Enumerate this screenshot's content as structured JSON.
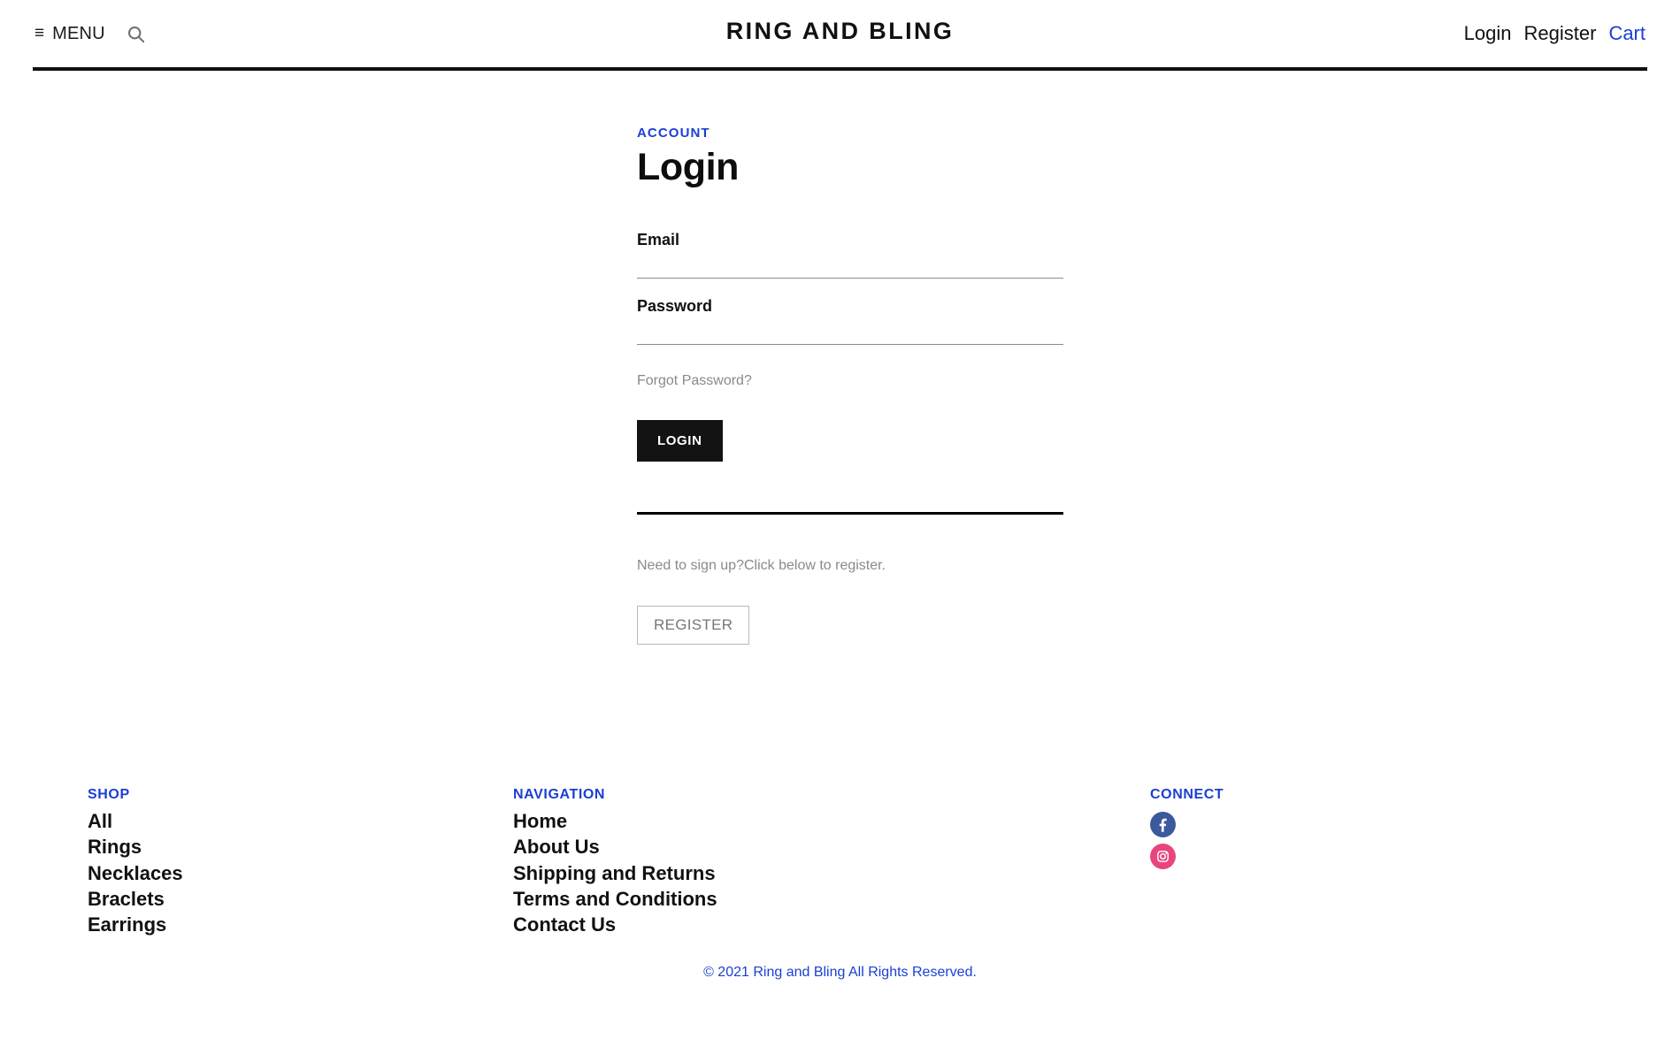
{
  "header": {
    "menu_icon": "hamburger-icon",
    "menu_label": "MENU",
    "search_icon": "search-icon",
    "brand": "RING AND BLING",
    "links": [
      {
        "label": "Login",
        "accent": false
      },
      {
        "label": "Register",
        "accent": false
      },
      {
        "label": "Cart",
        "accent": true
      }
    ]
  },
  "main": {
    "eyebrow": "ACCOUNT",
    "title": "Login",
    "fields": [
      {
        "label": "Email",
        "value": "",
        "placeholder": ""
      },
      {
        "label": "Password",
        "value": "",
        "placeholder": ""
      }
    ],
    "forgot_password": "Forgot Password?",
    "login_button": "LOGIN",
    "signup_prompt": "Need to sign up?Click below to register.",
    "register_button": "REGISTER"
  },
  "footer": {
    "shop": {
      "heading": "SHOP",
      "items": [
        "All",
        "Rings",
        "Necklaces",
        "Braclets",
        "Earrings"
      ]
    },
    "navigation": {
      "heading": "NAVIGATION",
      "items": [
        "Home",
        "About Us",
        "Shipping and Returns",
        "Terms and Conditions",
        "Contact Us"
      ]
    },
    "connect": {
      "heading": "CONNECT",
      "socials": [
        {
          "name": "facebook-icon",
          "color": "#3b5a9b"
        },
        {
          "name": "instagram-icon",
          "color": "#e8457e"
        }
      ]
    },
    "copyright": "© 2021 Ring and Bling All Rights Reserved."
  },
  "colors": {
    "accent_blue": "#1a3fd4",
    "button_black": "#131313",
    "muted_gray": "#8a8a8a"
  }
}
